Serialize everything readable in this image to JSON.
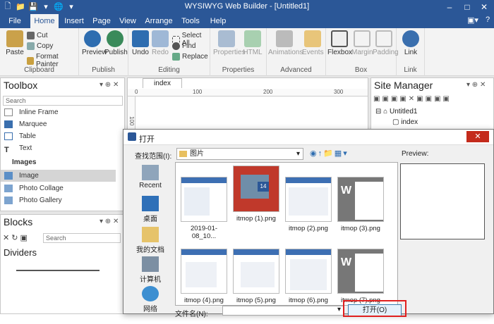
{
  "window": {
    "title": "WYSIWYG Web Builder - [Untitled1]",
    "minimize": "–",
    "maximize": "□",
    "close": "✕"
  },
  "menu": {
    "items": [
      "File",
      "Home",
      "Insert",
      "Page",
      "View",
      "Arrange",
      "Tools",
      "Help"
    ],
    "active": "Home"
  },
  "ribbon": {
    "clipboard": {
      "label": "Clipboard",
      "paste": "Paste",
      "cut": "Cut",
      "copy": "Copy",
      "format_painter": "Format Painter"
    },
    "publish": {
      "label": "Publish",
      "preview": "Preview",
      "publish": "Publish"
    },
    "editing": {
      "label": "Editing",
      "undo": "Undo",
      "redo": "Redo",
      "select_all": "Select All",
      "find": "Find",
      "replace": "Replace"
    },
    "properties": {
      "label": "Properties",
      "properties": "Properties",
      "html": "HTML"
    },
    "advanced": {
      "label": "Advanced",
      "animations": "Animations",
      "events": "Events"
    },
    "box": {
      "label": "Box",
      "flexbox": "Flexbox",
      "margin": "Margin",
      "padding": "Padding"
    },
    "link": {
      "label": "Link",
      "link": "Link"
    }
  },
  "toolbox": {
    "title": "Toolbox",
    "search_placeholder": "Search",
    "items": [
      "Inline Frame",
      "Marquee",
      "Table",
      "Text"
    ],
    "section": "Images",
    "image_items": [
      "Image",
      "Photo Collage",
      "Photo Gallery"
    ],
    "selected": "Image"
  },
  "blocks": {
    "title": "Blocks",
    "search_placeholder": "Search",
    "section": "Dividers"
  },
  "document": {
    "tab": "index",
    "ruler_marks": [
      "0",
      "100",
      "200",
      "300"
    ],
    "v_ruler_mark": "100"
  },
  "site_manager": {
    "title": "Site Manager",
    "root": "Untitled1",
    "page": "index"
  },
  "dialog": {
    "title": "打开",
    "look_in_label": "查找范围(I):",
    "look_in_value": "图片",
    "preview_label": "Preview:",
    "places": [
      "Recent",
      "桌面",
      "我的文档",
      "计算机",
      "网络"
    ],
    "files": [
      "2019-01-08_10...",
      "itmop (1).png",
      "itmop (2).png",
      "itmop (3).png",
      "itmop (4).png",
      "itmop (5).png",
      "itmop (6).png",
      "itmop (7).png"
    ],
    "filename_label": "文件名(N):",
    "open_button": "打开(O)",
    "thumb_badge": "14"
  },
  "colors": {
    "titlebar": "#2b5797",
    "highlight": "#e0201f",
    "selection": "#d5d5d5"
  }
}
